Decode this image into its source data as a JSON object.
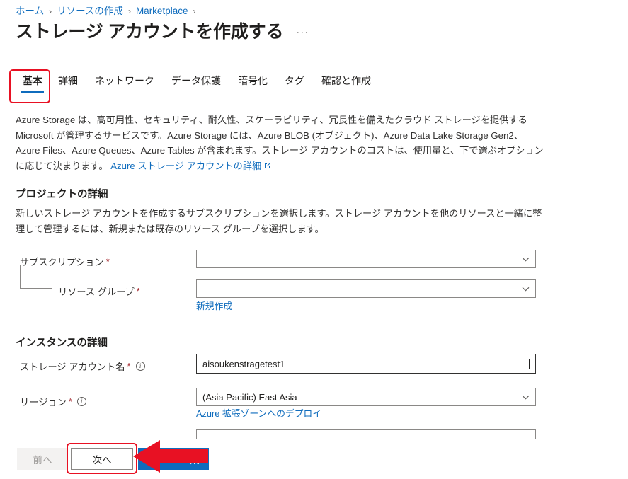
{
  "breadcrumb": {
    "items": [
      {
        "label": "ホーム"
      },
      {
        "label": "リソースの作成"
      },
      {
        "label": "Marketplace"
      }
    ],
    "separator": "›"
  },
  "header": {
    "title": "ストレージ アカウントを作成する",
    "more_label": "···"
  },
  "tabs": [
    {
      "label": "基本",
      "active": true
    },
    {
      "label": "詳細",
      "active": false
    },
    {
      "label": "ネットワーク",
      "active": false
    },
    {
      "label": "データ保護",
      "active": false
    },
    {
      "label": "暗号化",
      "active": false
    },
    {
      "label": "タグ",
      "active": false
    },
    {
      "label": "確認と作成",
      "active": false
    }
  ],
  "intro": {
    "text": "Azure Storage は、高可用性、セキュリティ、耐久性、スケーラビリティ、冗長性を備えたクラウド ストレージを提供する Microsoft が管理するサービスです。Azure Storage には、Azure BLOB (オブジェクト)、Azure Data Lake Storage Gen2、Azure Files、Azure Queues、Azure Tables が含まれます。ストレージ アカウントのコストは、使用量と、下で選ぶオプションに応じて決まります。",
    "link_label": "Azure ストレージ アカウントの詳細"
  },
  "project_section": {
    "title": "プロジェクトの詳細",
    "description": "新しいストレージ アカウントを作成するサブスクリプションを選択します。ストレージ アカウントを他のリソースと一緒に整理して管理するには、新規または既存のリソース グループを選択します。",
    "subscription": {
      "label": "サブスクリプション",
      "required": "*",
      "value": ""
    },
    "resource_group": {
      "label": "リソース グループ",
      "required": "*",
      "value": "",
      "create_new_label": "新規作成"
    }
  },
  "instance_section": {
    "title": "インスタンスの詳細",
    "storage_account_name": {
      "label": "ストレージ アカウント名",
      "required": "*",
      "value": "aisoukenstragetest1",
      "info_icon": "info-icon"
    },
    "region": {
      "label": "リージョン",
      "required": "*",
      "value": "(Asia Pacific) East Asia",
      "info_icon": "info-icon",
      "edge_zone_link": "Azure 拡張ゾーンへのデプロイ"
    }
  },
  "footer": {
    "previous_label": "前へ",
    "next_label": "次へ",
    "create_label": "成"
  },
  "annotations": {
    "color": "#e81123",
    "arrow_direction": "left",
    "highlighted": [
      "基本",
      "次へ"
    ]
  },
  "theme": {
    "link_color": "#0f6cbd",
    "primary_button": "#0f6cbd",
    "required_color": "#a4262c",
    "border_color": "#8a8886",
    "text_color": "#323130"
  }
}
